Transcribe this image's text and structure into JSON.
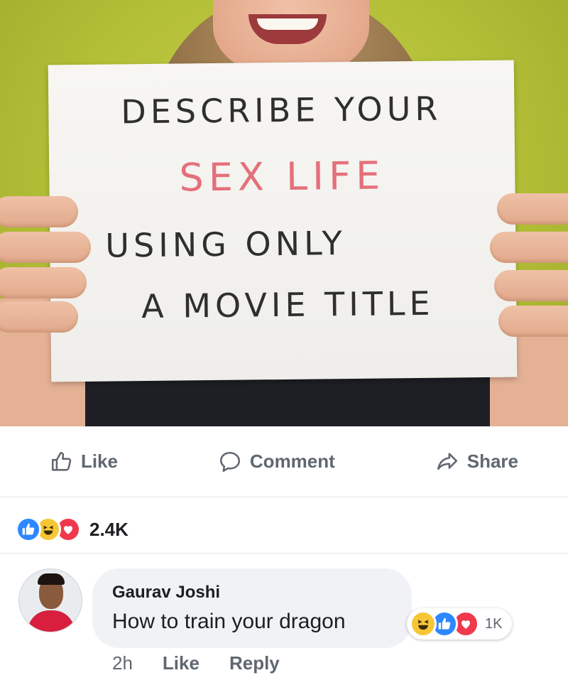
{
  "post": {
    "sign_lines": [
      "DESCRIBE YOUR",
      "SEX LIFE",
      "USING ONLY",
      "A MOVIE TITLE"
    ]
  },
  "actions": {
    "like_label": "Like",
    "comment_label": "Comment",
    "share_label": "Share"
  },
  "reactions": {
    "icons": [
      "like-icon",
      "haha-icon",
      "love-icon"
    ],
    "count": "2.4K"
  },
  "comment": {
    "author": "Gaurav Joshi",
    "text": "How to train your dragon",
    "reaction_icons": [
      "haha-icon",
      "like-icon",
      "love-icon"
    ],
    "reaction_count": "1K",
    "time": "2h",
    "like_label": "Like",
    "reply_label": "Reply"
  },
  "colors": {
    "like_blue": "#2d88ff",
    "haha_yellow": "#f7c635",
    "love_red": "#f0394c",
    "sign_text_dark": "#2f302c",
    "sign_text_red": "#e4707a",
    "background_green": "#b7c238"
  }
}
